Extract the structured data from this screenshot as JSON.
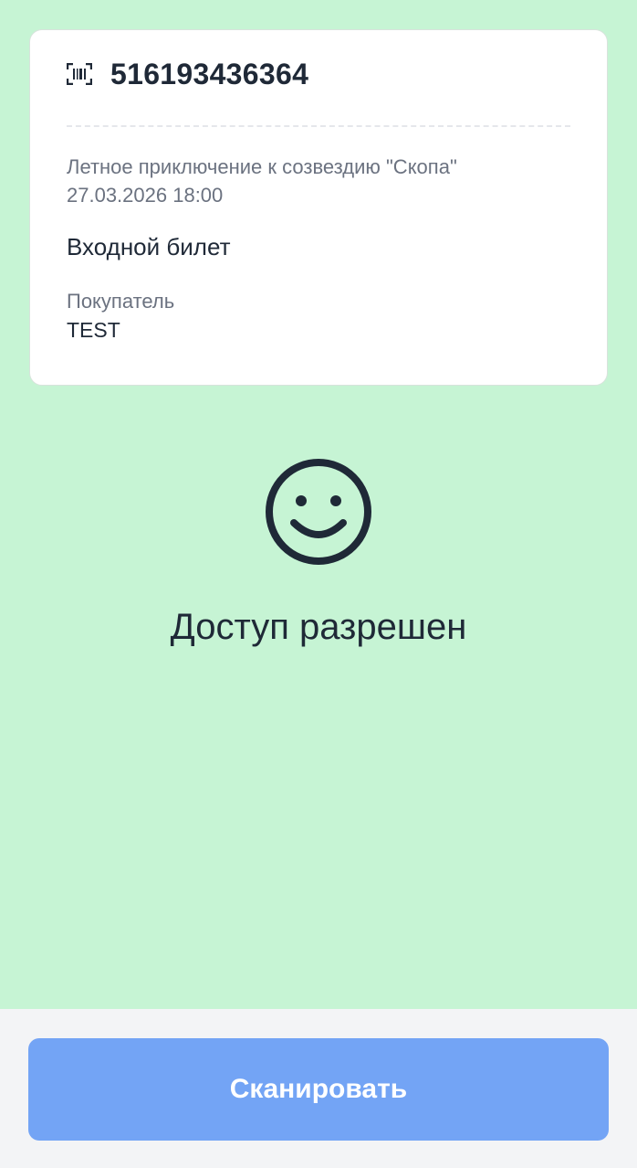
{
  "ticket": {
    "number": "516193436364",
    "event_title": "Летное приключение к созвездию \"Скопа\"",
    "event_datetime": "27.03.2026 18:00",
    "ticket_type": "Входной билет",
    "buyer_label": "Покупатель",
    "buyer_name": "TEST"
  },
  "status": {
    "icon": "smiley-face-icon",
    "text": "Доступ разрешен"
  },
  "actions": {
    "scan_label": "Сканировать"
  },
  "colors": {
    "success_background": "#c6f4d4",
    "button_background": "#73a4f5",
    "card_background": "#ffffff"
  }
}
